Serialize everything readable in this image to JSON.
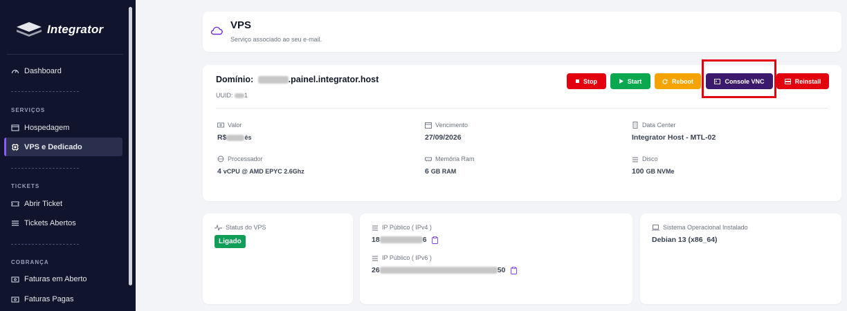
{
  "brand": {
    "name": "Integrator"
  },
  "sidebar": {
    "dashboard": "Dashboard",
    "sections": {
      "services": "SERVIÇOS",
      "tickets": "TICKETS",
      "billing": "COBRANÇA"
    },
    "items": {
      "hosting": "Hospedagem",
      "vps": "VPS e Dedicado",
      "open_ticket": "Abrir Ticket",
      "open_tickets": "Tickets Abertos",
      "open_invoices": "Faturas em Aberto",
      "paid_invoices": "Faturas Pagas"
    }
  },
  "header": {
    "title": "VPS",
    "subtitle": "Serviço associado ao seu e-mail."
  },
  "service": {
    "domain_label": "Domínio:",
    "domain_suffix": ".painel.integrator.host",
    "uuid_label": "UUID:",
    "uuid_suffix": "1",
    "actions": {
      "stop": "Stop",
      "start": "Start",
      "reboot": "Reboot",
      "console": "Console VNC",
      "reinstall": "Reinstall"
    },
    "details": {
      "valor_label": "Valor",
      "valor_prefix": "R$",
      "valor_suffix": "ês",
      "vencimento_label": "Vencimento",
      "vencimento": "27/09/2026",
      "datacenter_label": "Data Center",
      "datacenter": "Integrator Host - MTL-02",
      "processador_label": "Processador",
      "processador_num": "4",
      "processador_unit": "vCPU @ AMD EPYC 2.6Ghz",
      "memoria_label": "Memória Ram",
      "memoria_num": "6",
      "memoria_unit": "GB RAM",
      "disco_label": "Disco",
      "disco_num": "100",
      "disco_unit": "GB NVMe"
    }
  },
  "status": {
    "label": "Status do VPS",
    "value": "Ligado"
  },
  "network": {
    "ipv4_label": "IP Público ( IPv4 )",
    "ipv4_prefix": "18",
    "ipv4_suffix": "6",
    "ipv6_label": "IP Público ( IPv6 )",
    "ipv6_prefix": "26",
    "ipv6_suffix": "50"
  },
  "os": {
    "label": "Sistema Operacional Instalado",
    "value": "Debian 13 (x86_64)"
  },
  "colors": {
    "stop": "#e3000f",
    "start": "#0aa84f",
    "reboot": "#f5a300",
    "console": "#3b1a6d",
    "reinstall": "#e3000f",
    "highlight": "#e3000f",
    "sidebar": "#10142c"
  }
}
